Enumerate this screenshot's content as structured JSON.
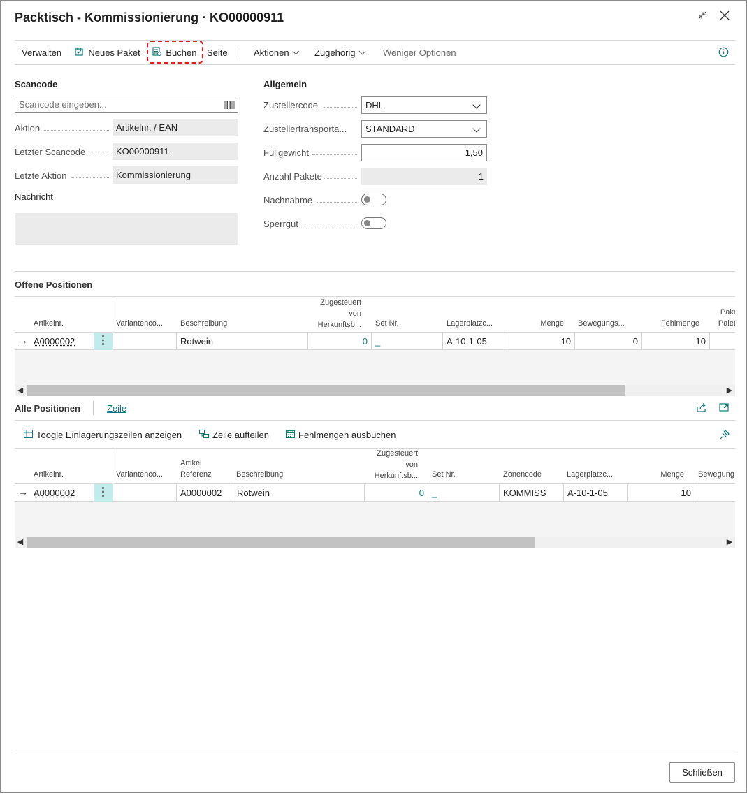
{
  "window": {
    "title": "Packtisch - Kommissionierung · KO00000911",
    "close_label": "Schließen"
  },
  "toolbar": {
    "verwalten": "Verwalten",
    "neues_paket": "Neues Paket",
    "buchen": "Buchen",
    "seite": "Seite",
    "aktionen": "Aktionen",
    "zugehoerig": "Zugehörig",
    "weniger": "Weniger Optionen"
  },
  "scancode": {
    "heading": "Scancode",
    "placeholder": "Scancode eingeben...",
    "aktion_label": "Aktion",
    "aktion_value": "Artikelnr. / EAN",
    "letzter_label": "Letzter Scancode",
    "letzter_value": "KO00000911",
    "letzte_aktion_label": "Letzte Aktion",
    "letzte_aktion_value": "Kommissionierung",
    "nachricht_label": "Nachricht",
    "nachricht_value": ""
  },
  "allgemein": {
    "heading": "Allgemein",
    "zustellercode_label": "Zustellercode",
    "zustellercode_value": "DHL",
    "transport_label": "Zustellertransporta...",
    "transport_value": "STANDARD",
    "fuellgewicht_label": "Füllgewicht",
    "fuellgewicht_value": "1,50",
    "anzahl_label": "Anzahl Pakete",
    "anzahl_value": "1",
    "nachnahme_label": "Nachnahme",
    "nachnahme_value": false,
    "sperrgut_label": "Sperrgut",
    "sperrgut_value": false
  },
  "offene": {
    "heading": "Offene Positionen",
    "headers": {
      "artikelnr": "Artikelnr.",
      "variant": "Variantenco...",
      "beschreibung": "Beschreibung",
      "zugesteuert_1": "Zugesteuert",
      "zugesteuert_2": "von",
      "zugesteuert_3": "Herkunftsb...",
      "setnr": "Set Nr.",
      "lager": "Lagerplatzc...",
      "menge": "Menge",
      "bewegung": "Bewegungs...",
      "fehlmenge": "Fehlmenge",
      "paket_1": "Pake",
      "paket_2": "Palett"
    },
    "row": {
      "artikelnr": "A0000002",
      "variant": "",
      "beschreibung": "Rotwein",
      "zugesteuert": "0",
      "setnr": "_",
      "lager": "A-10-1-05",
      "menge": "10",
      "bewegung": "0",
      "fehlmenge": "10"
    }
  },
  "alle": {
    "heading": "Alle Positionen",
    "tab_zeile": "Zeile",
    "actions": {
      "toggle": "Toogle Einlagerungszeilen anzeigen",
      "aufteilen": "Zeile aufteilen",
      "fehlmengen": "Fehlmengen ausbuchen"
    },
    "headers": {
      "artikelnr": "Artikelnr.",
      "variant": "Variantenco...",
      "ref_1": "Artikel",
      "ref_2": "Referenz",
      "beschreibung": "Beschreibung",
      "zugesteuert_1": "Zugesteuert",
      "zugesteuert_2": "von",
      "zugesteuert_3": "Herkunftsb...",
      "setnr": "Set Nr.",
      "zone": "Zonencode",
      "lager": "Lagerplatzc...",
      "menge": "Menge",
      "bewegung": "Bewegung"
    },
    "row": {
      "artikelnr": "A0000002",
      "variant": "",
      "referenz": "A0000002",
      "beschreibung": "Rotwein",
      "zugesteuert": "0",
      "setnr": "_",
      "zone": "KOMMISS",
      "lager": "A-10-1-05",
      "menge": "10",
      "bewegung": ""
    }
  },
  "colors": {
    "accent": "#0e7a7a",
    "focus": "#e02020"
  },
  "icons": [
    "collapse-icon",
    "close-icon",
    "new-package-icon",
    "post-icon",
    "info-icon",
    "barcode-icon",
    "share-icon",
    "expand-icon",
    "pin-icon"
  ]
}
